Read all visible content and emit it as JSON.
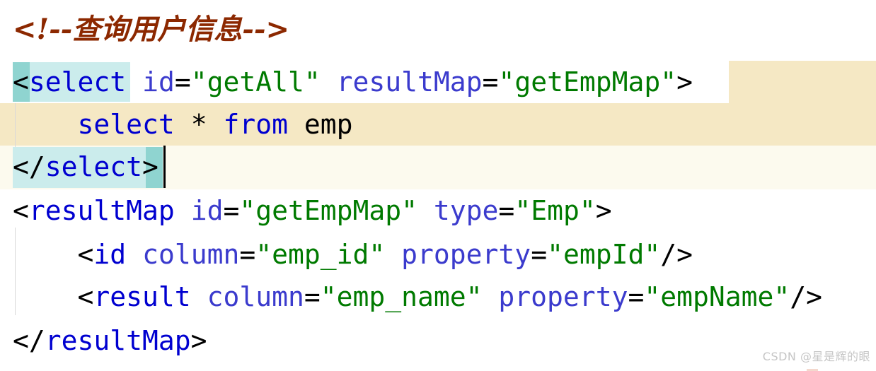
{
  "editor": {
    "language": "xml",
    "file_type": "MyBatis mapper XML",
    "colors": {
      "background": "#ffffff",
      "tag": "#0000d0",
      "attribute": "#3b3bcd",
      "attribute_value": "#007a00",
      "punctuation": "#000000",
      "comment": "#8c2800",
      "selection_light": "#cbecec",
      "selection_dark": "#8fd4d0",
      "block_band_dark": "#f5e8c4",
      "block_band_light": "#fcfaee",
      "indent_guide": "#d8d8d8",
      "watermark": "#bcbcbc"
    },
    "lines": [
      {
        "n": 1,
        "text": "<!--查询用户信息-->",
        "tokens": [
          {
            "t": "<!--查询用户信息-->",
            "k": "comment"
          }
        ]
      },
      {
        "n": 2,
        "text": "<select id=\"getAll\" resultMap=\"getEmpMap\">",
        "tokens": [
          {
            "t": "<",
            "k": "punct"
          },
          {
            "t": "select",
            "k": "tag"
          },
          {
            "t": " ",
            "k": "plain"
          },
          {
            "t": "id",
            "k": "attr"
          },
          {
            "t": "=",
            "k": "punct"
          },
          {
            "t": "\"getAll\"",
            "k": "val"
          },
          {
            "t": " ",
            "k": "plain"
          },
          {
            "t": "resultMap",
            "k": "attr"
          },
          {
            "t": "=",
            "k": "punct"
          },
          {
            "t": "\"getEmpMap\"",
            "k": "val"
          },
          {
            "t": ">",
            "k": "punct"
          }
        ]
      },
      {
        "n": 3,
        "text": "    select * from emp",
        "tokens": [
          {
            "t": "    ",
            "k": "plain"
          },
          {
            "t": "select",
            "k": "tag"
          },
          {
            "t": " ",
            "k": "plain"
          },
          {
            "t": "*",
            "k": "plain"
          },
          {
            "t": " ",
            "k": "plain"
          },
          {
            "t": "from",
            "k": "tag"
          },
          {
            "t": " ",
            "k": "plain"
          },
          {
            "t": "emp",
            "k": "plain"
          }
        ]
      },
      {
        "n": 4,
        "text": "</select>",
        "tokens": [
          {
            "t": "</",
            "k": "punct"
          },
          {
            "t": "select",
            "k": "tag"
          },
          {
            "t": ">",
            "k": "punct"
          }
        ]
      },
      {
        "n": 5,
        "text": "<resultMap id=\"getEmpMap\" type=\"Emp\">",
        "tokens": [
          {
            "t": "<",
            "k": "punct"
          },
          {
            "t": "resultMap",
            "k": "tag"
          },
          {
            "t": " ",
            "k": "plain"
          },
          {
            "t": "id",
            "k": "attr"
          },
          {
            "t": "=",
            "k": "punct"
          },
          {
            "t": "\"getEmpMap\"",
            "k": "val"
          },
          {
            "t": " ",
            "k": "plain"
          },
          {
            "t": "type",
            "k": "attr"
          },
          {
            "t": "=",
            "k": "punct"
          },
          {
            "t": "\"Emp\"",
            "k": "val"
          },
          {
            "t": ">",
            "k": "punct"
          }
        ]
      },
      {
        "n": 6,
        "text": "    <id column=\"emp_id\" property=\"empId\"/>",
        "tokens": [
          {
            "t": "    ",
            "k": "plain"
          },
          {
            "t": "<",
            "k": "punct"
          },
          {
            "t": "id",
            "k": "tag"
          },
          {
            "t": " ",
            "k": "plain"
          },
          {
            "t": "column",
            "k": "attr"
          },
          {
            "t": "=",
            "k": "punct"
          },
          {
            "t": "\"emp_id\"",
            "k": "val"
          },
          {
            "t": " ",
            "k": "plain"
          },
          {
            "t": "property",
            "k": "attr"
          },
          {
            "t": "=",
            "k": "punct"
          },
          {
            "t": "\"empId\"",
            "k": "val"
          },
          {
            "t": "/>",
            "k": "punct"
          }
        ]
      },
      {
        "n": 7,
        "text": "    <result column=\"emp_name\" property=\"empName\"/>",
        "tokens": [
          {
            "t": "    ",
            "k": "plain"
          },
          {
            "t": "<",
            "k": "punct"
          },
          {
            "t": "result",
            "k": "tag"
          },
          {
            "t": " ",
            "k": "plain"
          },
          {
            "t": "column",
            "k": "attr"
          },
          {
            "t": "=",
            "k": "punct"
          },
          {
            "t": "\"emp_name\"",
            "k": "val"
          },
          {
            "t": " ",
            "k": "plain"
          },
          {
            "t": "property",
            "k": "attr"
          },
          {
            "t": "=",
            "k": "punct"
          },
          {
            "t": "\"empName\"",
            "k": "val"
          },
          {
            "t": "/>",
            "k": "punct"
          }
        ]
      },
      {
        "n": 8,
        "text": "</resultMap>",
        "tokens": [
          {
            "t": "</",
            "k": "punct"
          },
          {
            "t": "resultMap",
            "k": "tag"
          },
          {
            "t": ">",
            "k": "punct"
          }
        ]
      }
    ]
  },
  "watermark": {
    "text": "CSDN @星是辉的眼"
  }
}
